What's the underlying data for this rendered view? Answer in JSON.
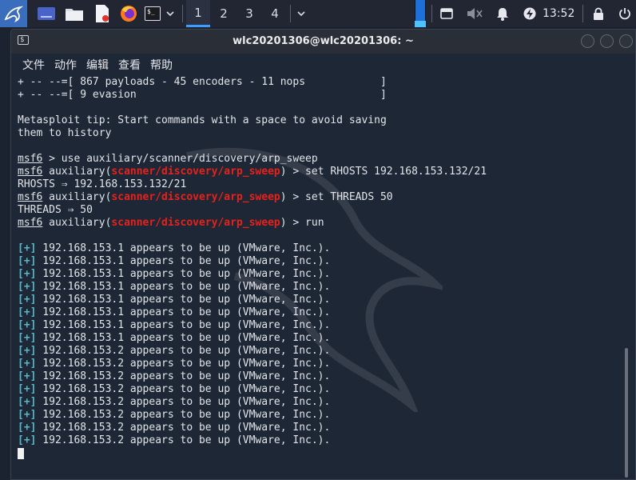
{
  "panel": {
    "workspaces": [
      "1",
      "2",
      "3",
      "4"
    ],
    "active_workspace": 0,
    "clock": "13:52",
    "icons": {
      "app_menu": "kali-dragon-icon",
      "show_desktop": "desktop-icon",
      "files": "folder-icon",
      "editor": "text-editor-icon",
      "browser": "firefox-icon",
      "terminal": "terminal-icon",
      "workspace_menu": "chevron-down-icon"
    }
  },
  "window": {
    "title": "wlc20201306@wlc20201306: ~",
    "menu": [
      "文件",
      "动作",
      "编辑",
      "查看",
      "帮助"
    ]
  },
  "terminal": {
    "banner": [
      "+ -- --=[ 867 payloads - 45 encoders - 11 nops            ]",
      "+ -- --=[ 9 evasion                                       ]"
    ],
    "tip": [
      "Metasploit tip: Start commands with a space to avoid saving",
      "them to history"
    ],
    "prompt": "msf6",
    "module_word": "auxiliary",
    "module_path": "scanner/discovery/arp_sweep",
    "cmd_use": " > use auxiliary/scanner/discovery/arp_sweep",
    "cmd_rhosts": ") > set RHOSTS 192.168.153.132/21",
    "out_rhosts": "RHOSTS ⇒ 192.168.153.132/21",
    "cmd_threads": ") > set THREADS 50",
    "out_threads": "THREADS ⇒ 50",
    "cmd_run": ") > run",
    "results_marker": "[+]",
    "results": [
      " 192.168.153.1 appears to be up (VMware, Inc.).",
      " 192.168.153.1 appears to be up (VMware, Inc.).",
      " 192.168.153.1 appears to be up (VMware, Inc.).",
      " 192.168.153.1 appears to be up (VMware, Inc.).",
      " 192.168.153.1 appears to be up (VMware, Inc.).",
      " 192.168.153.1 appears to be up (VMware, Inc.).",
      " 192.168.153.1 appears to be up (VMware, Inc.).",
      " 192.168.153.1 appears to be up (VMware, Inc.).",
      " 192.168.153.2 appears to be up (VMware, Inc.).",
      " 192.168.153.2 appears to be up (VMware, Inc.).",
      " 192.168.153.2 appears to be up (VMware, Inc.).",
      " 192.168.153.2 appears to be up (VMware, Inc.).",
      " 192.168.153.2 appears to be up (VMware, Inc.).",
      " 192.168.153.2 appears to be up (VMware, Inc.).",
      " 192.168.153.2 appears to be up (VMware, Inc.).",
      " 192.168.153.2 appears to be up (VMware, Inc.)."
    ]
  },
  "colors": {
    "accent": "#3b9eff",
    "module_red": "#e8211a",
    "success_cyan": "#58b8c8",
    "terminal_bg": "#1e2735"
  }
}
